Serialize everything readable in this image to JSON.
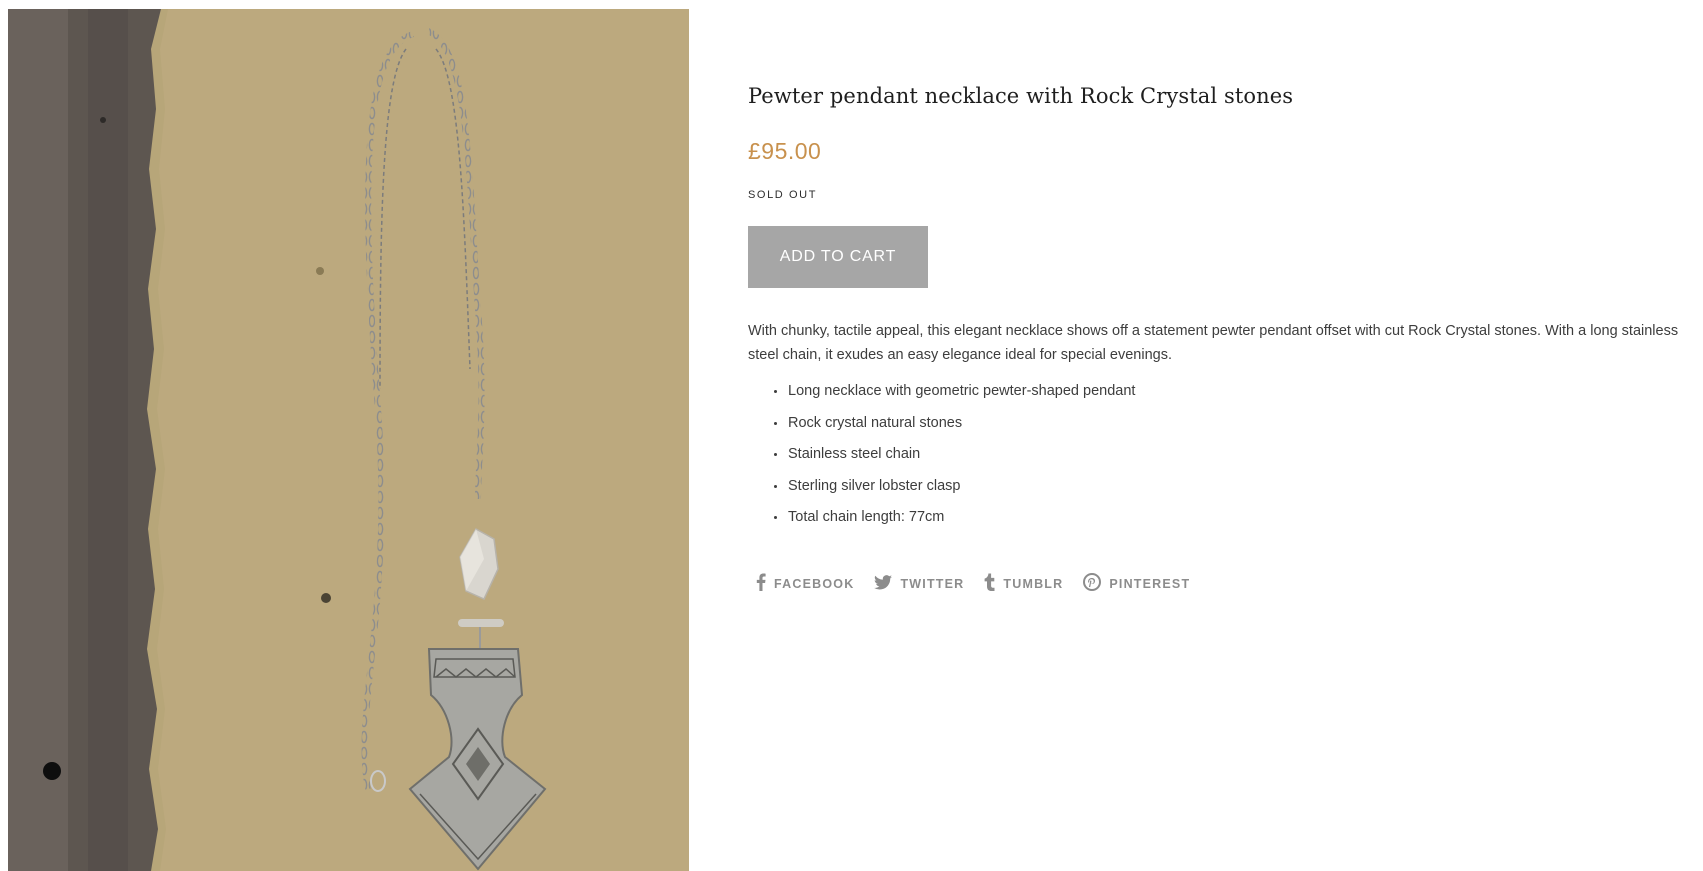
{
  "product": {
    "image_alt": "Pewter pendant necklace on a sheet of handmade paper",
    "title": "Pewter pendant necklace with Rock Crystal stones",
    "price": "£95.00",
    "stock_status": "SOLD OUT",
    "add_to_cart_label": "ADD TO CART",
    "description": "With chunky, tactile appeal, this elegant necklace shows off a statement pewter pendant offset with cut Rock Crystal stones. With a long stainless steel chain, it exudes an easy elegance ideal for special evenings.",
    "features": [
      "Long necklace with geometric pewter-shaped pendant",
      "Rock crystal natural stones",
      "Stainless steel chain",
      "Sterling silver lobster clasp",
      "Total chain length: 77cm"
    ]
  },
  "share": [
    {
      "label": "FACEBOOK",
      "icon": "facebook-icon"
    },
    {
      "label": "TWITTER",
      "icon": "twitter-icon"
    },
    {
      "label": "TUMBLR",
      "icon": "tumblr-icon"
    },
    {
      "label": "PINTEREST",
      "icon": "pinterest-icon"
    }
  ],
  "colors": {
    "price": "#c8914d",
    "button_bg": "#a6a6a6",
    "share_text": "#8c8c8c"
  }
}
